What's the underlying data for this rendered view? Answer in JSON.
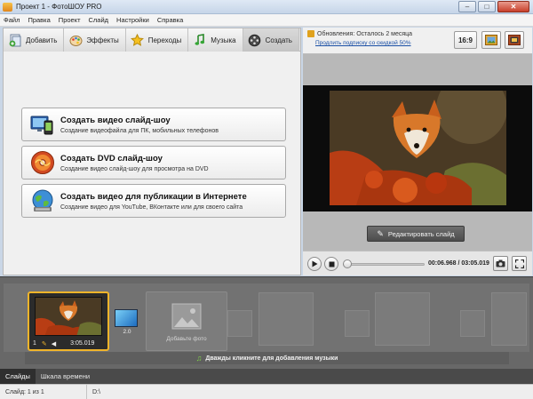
{
  "window": {
    "title": "Проект 1 - ФотоШОУ PRO",
    "minimize": "–",
    "maximize": "□",
    "close": "✕"
  },
  "menu": [
    "Файл",
    "Правка",
    "Проект",
    "Слайд",
    "Настройки",
    "Справка"
  ],
  "tabs": [
    {
      "label": "Добавить",
      "icon": "add-files-icon"
    },
    {
      "label": "Эффекты",
      "icon": "effects-palette-icon"
    },
    {
      "label": "Переходы",
      "icon": "transitions-star-icon"
    },
    {
      "label": "Музыка",
      "icon": "music-note-icon"
    },
    {
      "label": "Создать",
      "icon": "create-film-icon",
      "active": true
    }
  ],
  "actions": [
    {
      "title": "Создать видео слайд-шоу",
      "desc": "Создание видеофайла для ПК, мобильных телефонов",
      "icon": "video-devices-icon"
    },
    {
      "title": "Создать DVD слайд-шоу",
      "desc": "Создание видео слайд-шоу для просмотра на DVD",
      "icon": "dvd-disc-icon"
    },
    {
      "title": "Создать видео для публикации в Интернете",
      "desc": "Создание видео для YouTube, ВКонтакте или для своего сайта",
      "icon": "globe-web-icon"
    }
  ],
  "update": {
    "text": "Обновления: Осталось 2 месяца",
    "link": "Продлить подписку со скидкой 50%"
  },
  "aspect_ratio": "16:9",
  "preview": {
    "edit_button": "Редактировать слайд",
    "time": "00:06.968 / 03:05.019"
  },
  "slides": [
    {
      "number": "1",
      "duration": "3:05.019"
    }
  ],
  "transition": {
    "duration": "2.0"
  },
  "add_photo_label": "Добавьте фото",
  "music_hint": "Дважды кликните для добавления музыки",
  "bottom_tabs": [
    {
      "label": "Слайды",
      "active": true
    },
    {
      "label": "Шкала времени",
      "active": false
    }
  ],
  "status": {
    "slide": "Слайд: 1 из 1",
    "path": "D:\\"
  },
  "colors": {
    "accent_selection": "#f0b42a",
    "strip_bg": "#686868",
    "link": "#1a4fa5"
  }
}
